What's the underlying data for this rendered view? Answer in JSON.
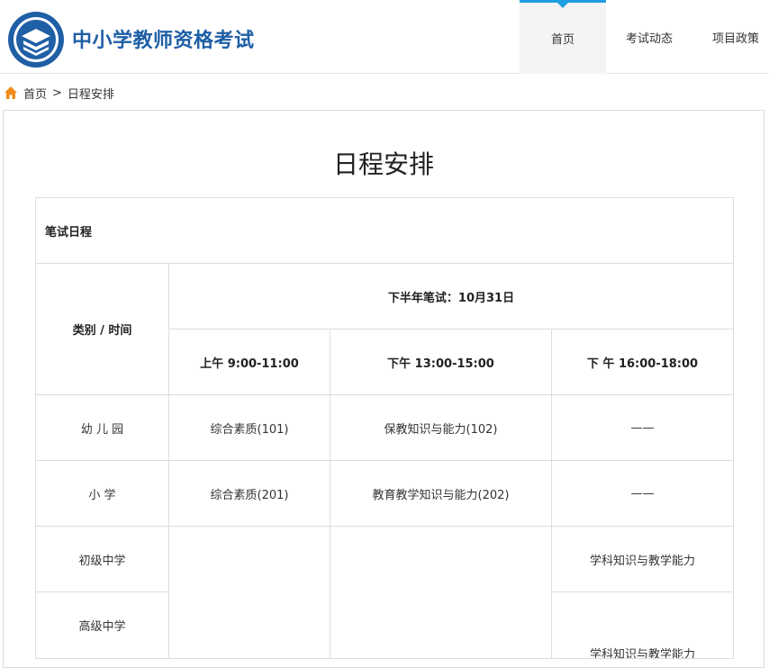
{
  "header": {
    "site_title": "中小学教师资格考试",
    "nav": [
      {
        "label": "首页",
        "active": true
      },
      {
        "label": "考试动态",
        "active": false
      },
      {
        "label": "项目政策",
        "active": false
      }
    ]
  },
  "breadcrumb": {
    "home": "首页",
    "separator": ">",
    "current": "日程安排"
  },
  "page": {
    "title": "日程安排"
  },
  "table": {
    "section_label": "笔试日程",
    "corner_header": "类别 /  时间",
    "exam_header": "下半年笔试：10月31日",
    "sessions": [
      "上午  9:00-11:00",
      "下午  13:00-15:00",
      "下 午  16:00-18:00"
    ],
    "rows": [
      {
        "category": "幼 儿 园",
        "s1": "综合素质(101)",
        "s2": "保教知识与能力(102)",
        "s3": "——"
      },
      {
        "category": "小    学",
        "s1": "综合素质(201)",
        "s2": "教育教学知识与能力(202)",
        "s3": "——"
      },
      {
        "category": "初级中学",
        "s3": "学科知识与教学能力"
      },
      {
        "category": "高级中学",
        "s3": "学科知识与教学能力"
      }
    ]
  },
  "colors": {
    "brand": "#1f5fa6",
    "accent": "#1e9fe0",
    "home_icon": "#f08c1c"
  }
}
